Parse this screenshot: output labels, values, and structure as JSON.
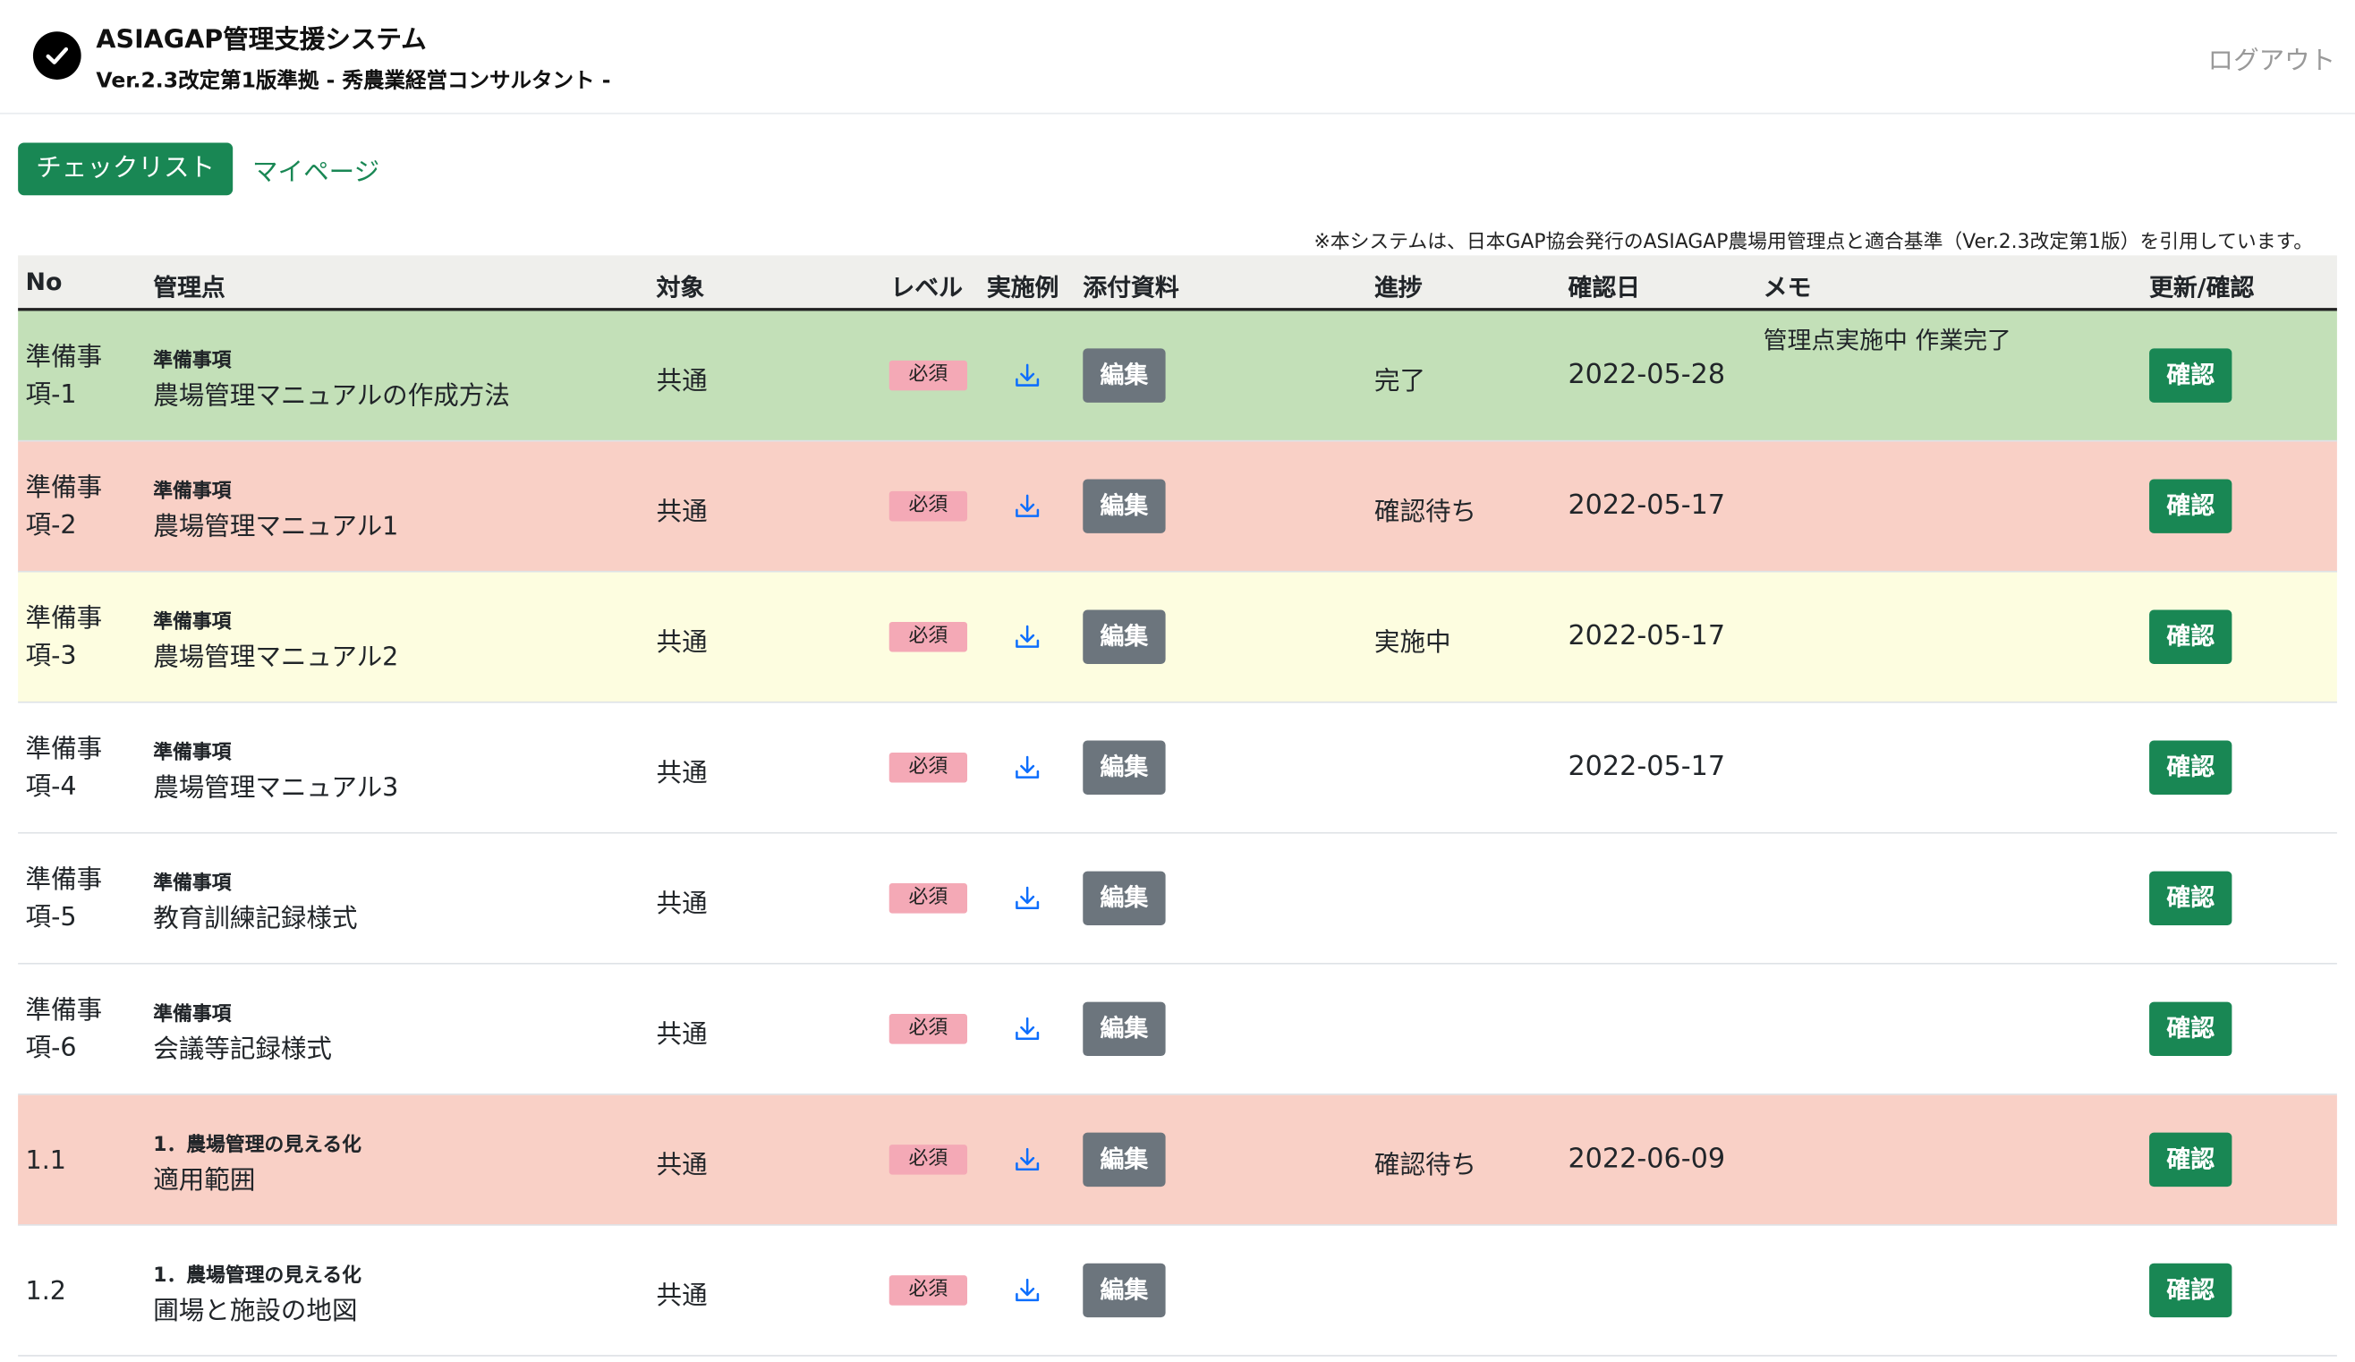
{
  "header": {
    "title": "ASIAGAP管理支援システム",
    "subtitle": "Ver.2.3改定第1版準拠 - 秀農業経営コンサルタント -",
    "logout_label": "ログアウト",
    "logo_icon": "check-circle-icon"
  },
  "nav": {
    "active_label": "チェックリスト",
    "mypage_label": "マイページ"
  },
  "notice": "※本システムは、日本GAP協会発行のASIAGAP農場用管理点と適合基準（Ver.2.3改定第1版）を引用しています。",
  "table": {
    "headers": {
      "no": "No",
      "point": "管理点",
      "target": "対象",
      "level": "レベル",
      "example": "実施例",
      "attachment": "添付資料",
      "progress": "進捗",
      "date": "確認日",
      "memo": "メモ",
      "update": "更新/確認"
    },
    "edit_label": "編集",
    "confirm_label": "確認",
    "rows": [
      {
        "no_line1": "準備事",
        "no_line2": "項-1",
        "category": "準備事項",
        "name": "農場管理マニュアルの作成方法",
        "target": "共通",
        "level": "必須",
        "progress": "完了",
        "date": "2022-05-28",
        "memo": "管理点実施中 作業完了",
        "bg": "#c3e0b8"
      },
      {
        "no_line1": "準備事",
        "no_line2": "項-2",
        "category": "準備事項",
        "name": "農場管理マニュアル1",
        "target": "共通",
        "level": "必須",
        "progress": "確認待ち",
        "date": "2022-05-17",
        "memo": "",
        "bg": "#f9d0c6"
      },
      {
        "no_line1": "準備事",
        "no_line2": "項-3",
        "category": "準備事項",
        "name": "農場管理マニュアル2",
        "target": "共通",
        "level": "必須",
        "progress": "実施中",
        "date": "2022-05-17",
        "memo": "",
        "bg": "#fdfde0"
      },
      {
        "no_line1": "準備事",
        "no_line2": "項-4",
        "category": "準備事項",
        "name": "農場管理マニュアル3",
        "target": "共通",
        "level": "必須",
        "progress": "",
        "date": "2022-05-17",
        "memo": "",
        "bg": "#ffffff"
      },
      {
        "no_line1": "準備事",
        "no_line2": "項-5",
        "category": "準備事項",
        "name": "教育訓練記録様式",
        "target": "共通",
        "level": "必須",
        "progress": "",
        "date": "",
        "memo": "",
        "bg": "#ffffff"
      },
      {
        "no_line1": "準備事",
        "no_line2": "項-6",
        "category": "準備事項",
        "name": "会議等記録様式",
        "target": "共通",
        "level": "必須",
        "progress": "",
        "date": "",
        "memo": "",
        "bg": "#ffffff"
      },
      {
        "no_line1": "1.1",
        "no_line2": "",
        "category": "1．農場管理の見える化",
        "name": "適用範囲",
        "target": "共通",
        "level": "必須",
        "progress": "確認待ち",
        "date": "2022-06-09",
        "memo": "",
        "bg": "#f9d0c6"
      },
      {
        "no_line1": "1.2",
        "no_line2": "",
        "category": "1．農場管理の見える化",
        "name": "圃場と施設の地図",
        "target": "共通",
        "level": "必須",
        "progress": "",
        "date": "",
        "memo": "",
        "bg": "#ffffff"
      }
    ]
  }
}
